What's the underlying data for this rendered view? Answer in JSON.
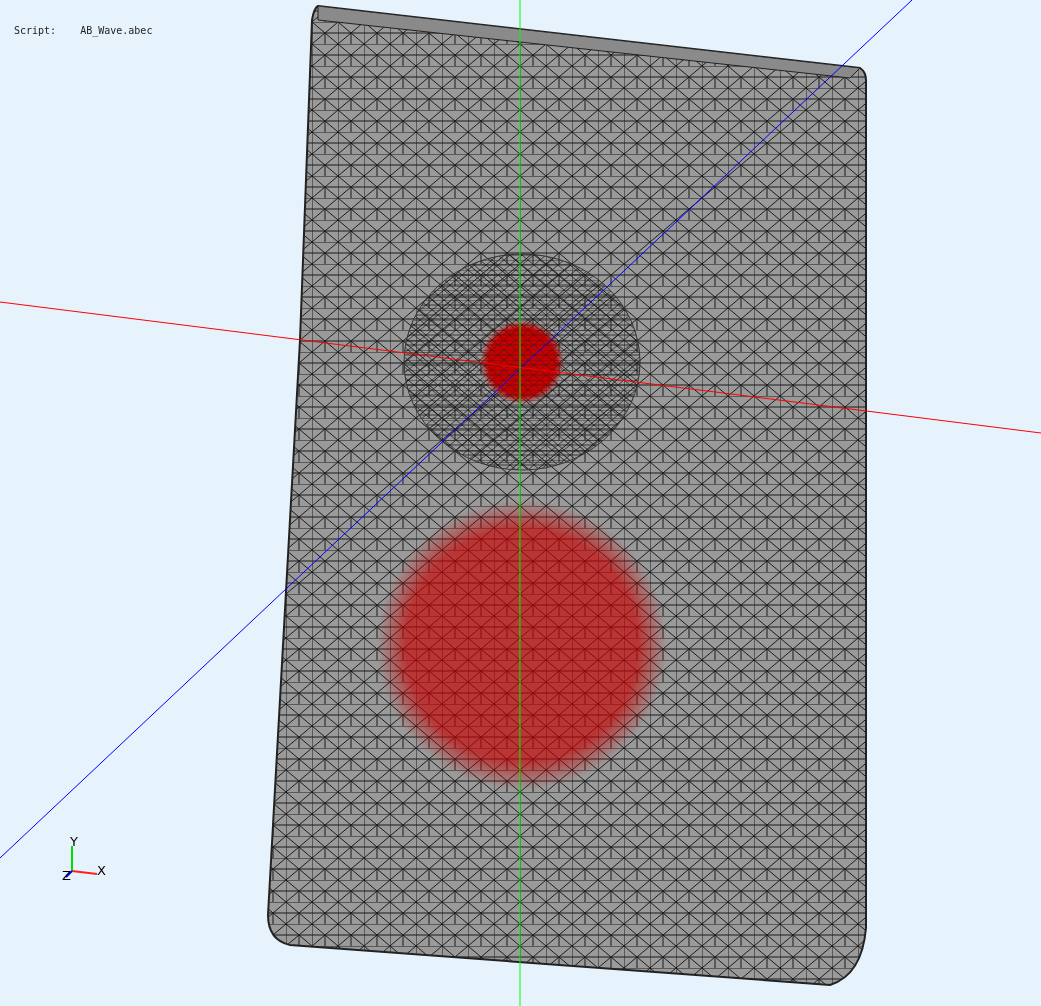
{
  "script_label": {
    "label": "Script:",
    "value": "AB_Wave.abec"
  },
  "axis_gizmo": {
    "x_label": "X",
    "y_label": "Y",
    "z_label": "Z"
  }
}
